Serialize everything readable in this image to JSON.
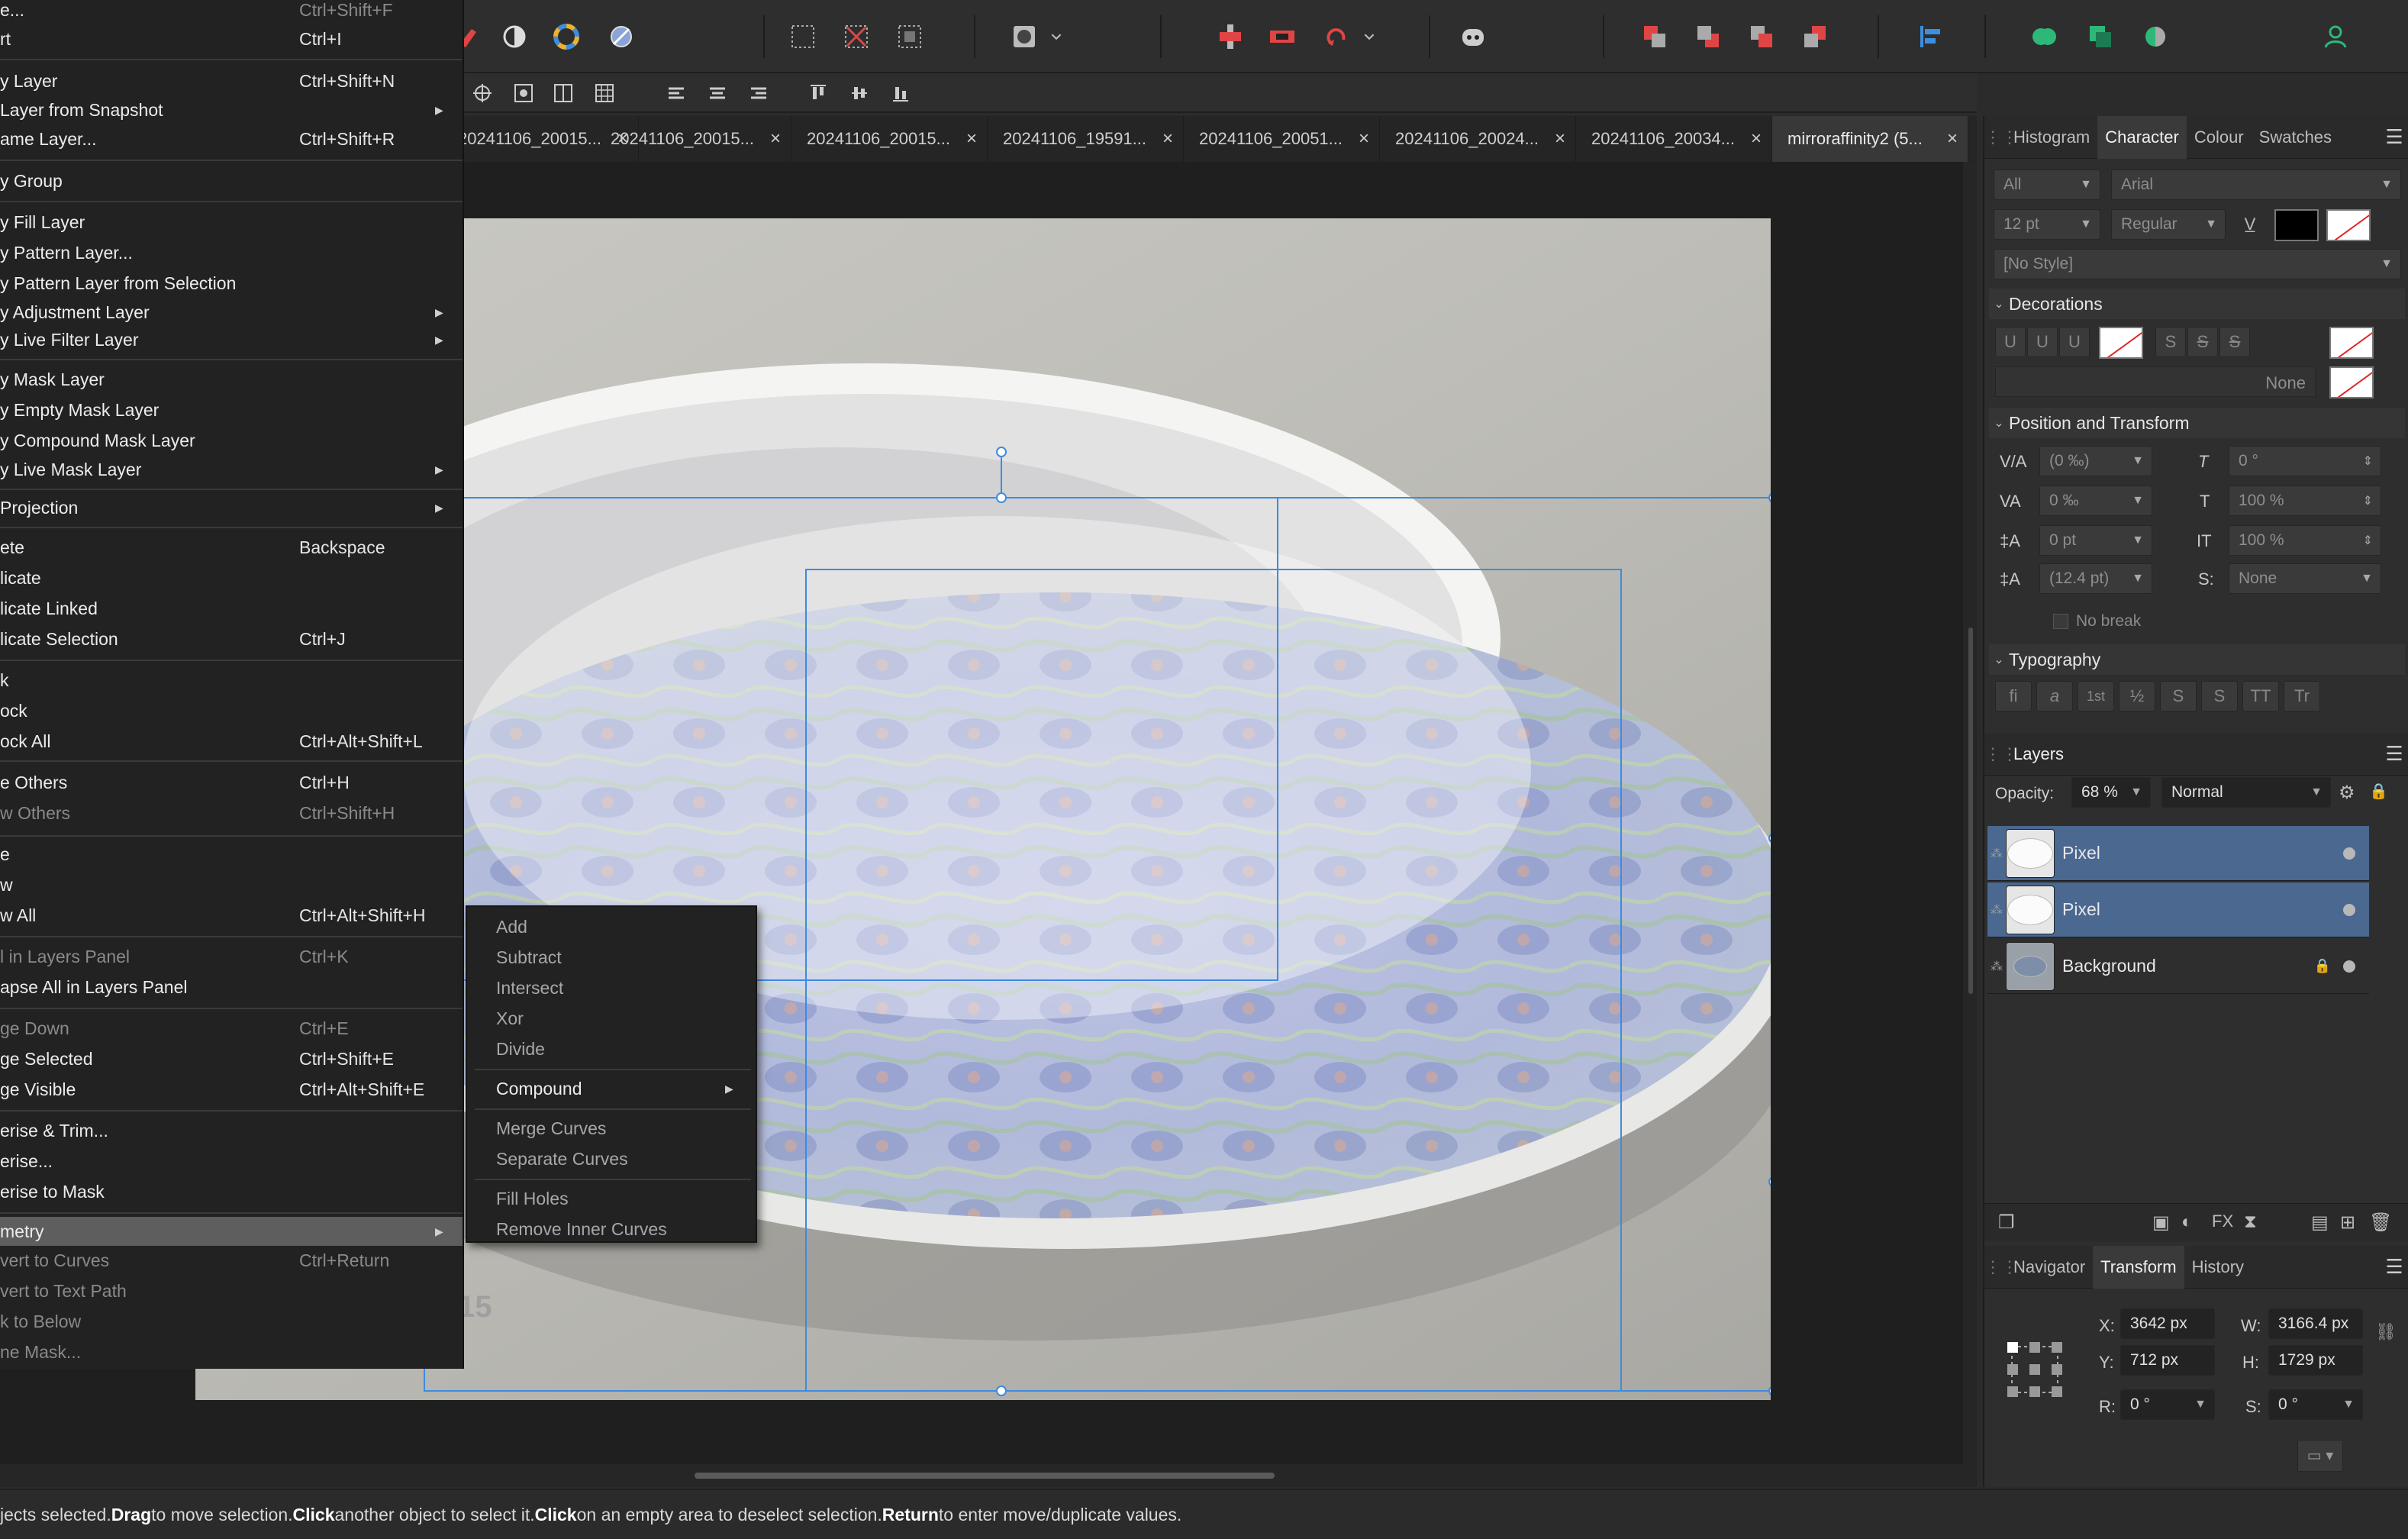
{
  "tabs": [
    {
      "label": "20241106_20015..."
    },
    {
      "label": "20241106_20015..."
    },
    {
      "label": "20241106_20015..."
    },
    {
      "label": "20241106_19591..."
    },
    {
      "label": "20241106_20051..."
    },
    {
      "label": "20241106_20024..."
    },
    {
      "label": "20241106_20034..."
    },
    {
      "label": "mirroraffinity2 (5..."
    }
  ],
  "tab_close_glyph": "×",
  "canvas_number": "15",
  "menu": {
    "items": [
      {
        "label": "e...",
        "shortcut": "Ctrl+Shift+F"
      },
      {
        "label": "rt",
        "shortcut": "Ctrl+I"
      },
      {
        "label": "y Layer",
        "shortcut": "Ctrl+Shift+N"
      },
      {
        "label": "Layer from Snapshot",
        "shortcut": ""
      },
      {
        "label": "ame Layer...",
        "shortcut": "Ctrl+Shift+R"
      },
      {
        "label": "y Group",
        "shortcut": ""
      },
      {
        "label": "y Fill Layer",
        "shortcut": ""
      },
      {
        "label": "y Pattern Layer...",
        "shortcut": ""
      },
      {
        "label": "y Pattern Layer from Selection",
        "shortcut": ""
      },
      {
        "label": "y Adjustment Layer",
        "shortcut": ""
      },
      {
        "label": "y Live Filter Layer",
        "shortcut": ""
      },
      {
        "label": "y Mask Layer",
        "shortcut": ""
      },
      {
        "label": "y Empty Mask Layer",
        "shortcut": ""
      },
      {
        "label": "y Compound Mask Layer",
        "shortcut": ""
      },
      {
        "label": "y Live Mask Layer",
        "shortcut": ""
      },
      {
        "label": "Projection",
        "shortcut": ""
      },
      {
        "label": "ete",
        "shortcut": "Backspace"
      },
      {
        "label": "licate",
        "shortcut": ""
      },
      {
        "label": "licate Linked",
        "shortcut": ""
      },
      {
        "label": "licate Selection",
        "shortcut": "Ctrl+J"
      },
      {
        "label": "k",
        "shortcut": ""
      },
      {
        "label": "ock",
        "shortcut": ""
      },
      {
        "label": "ock All",
        "shortcut": "Ctrl+Alt+Shift+L"
      },
      {
        "label": "e Others",
        "shortcut": "Ctrl+H"
      },
      {
        "label": "w Others",
        "shortcut": "Ctrl+Shift+H"
      },
      {
        "label": "e",
        "shortcut": ""
      },
      {
        "label": "w",
        "shortcut": ""
      },
      {
        "label": "w All",
        "shortcut": "Ctrl+Alt+Shift+H"
      },
      {
        "label": "l in Layers Panel",
        "shortcut": "Ctrl+K"
      },
      {
        "label": "apse All in Layers Panel",
        "shortcut": ""
      },
      {
        "label": "ge Down",
        "shortcut": "Ctrl+E"
      },
      {
        "label": "ge Selected",
        "shortcut": "Ctrl+Shift+E"
      },
      {
        "label": "ge Visible",
        "shortcut": "Ctrl+Alt+Shift+E"
      },
      {
        "label": "erise & Trim...",
        "shortcut": ""
      },
      {
        "label": "erise...",
        "shortcut": ""
      },
      {
        "label": "erise to Mask",
        "shortcut": ""
      },
      {
        "label": "metry",
        "shortcut": ""
      },
      {
        "label": "vert to Curves",
        "shortcut": "Ctrl+Return"
      },
      {
        "label": "vert to Text Path",
        "shortcut": ""
      },
      {
        "label": "k to Below",
        "shortcut": ""
      },
      {
        "label": "ne Mask...",
        "shortcut": ""
      }
    ],
    "arrow_glyph": "▶"
  },
  "submenu": {
    "items": [
      "Add",
      "Subtract",
      "Intersect",
      "Xor",
      "Divide",
      "Compound",
      "Merge Curves",
      "Separate Curves",
      "Fill Holes",
      "Remove Inner Curves"
    ]
  },
  "panel": {
    "top_tabs": [
      "Histogram",
      "Character",
      "Colour",
      "Swatches"
    ],
    "character": {
      "font_collection": "All",
      "font_family": "Arial",
      "font_size": "12 pt",
      "font_style": "Regular",
      "paragraph_style": "[No Style]",
      "decorations_title": "Decorations",
      "decoration_none": "None",
      "position_title": "Position and Transform",
      "kerning": "(0 ‰)",
      "tracking": "0 ‰",
      "baseline": "0 pt",
      "leading": "(12.4 pt)",
      "shear": "0 °",
      "scale_h": "100 %",
      "scale_v": "100 %",
      "typography_case": "None",
      "no_break": "No break",
      "typography_title": "Typography",
      "deco_glyphs": [
        "U",
        "U",
        "U",
        "S",
        "S",
        "S"
      ],
      "typo_glyphs": [
        "fi",
        "a",
        "1st",
        "½",
        "S",
        "S",
        "TT",
        "Tr"
      ],
      "accent_colors": {
        "fill": "#000000"
      }
    },
    "layers": {
      "tab": "Layers",
      "opacity_label": "Opacity:",
      "opacity": "68 %",
      "blend_mode": "Normal",
      "rows": [
        {
          "name": "Pixel",
          "selected": true
        },
        {
          "name": "Pixel",
          "selected": true
        },
        {
          "name": "Background",
          "selected": false
        }
      ]
    },
    "bottom_tabs": [
      "Navigator",
      "Transform",
      "History"
    ],
    "transform": {
      "x_label": "X:",
      "x": "3642 px",
      "y_label": "Y:",
      "y": "712 px",
      "w_label": "W:",
      "w": "3166.4 px",
      "h_label": "H:",
      "h": "1729 px",
      "r_label": "R:",
      "r": "0 °",
      "s_label": "S:",
      "s": "0 °"
    }
  },
  "status": {
    "p1": "jects selected. ",
    "k1": "Drag",
    "p2": " to move selection. ",
    "k2": "Click",
    "p3": " another object to select it. ",
    "k3": "Click",
    "p4": " on an empty area to deselect selection. ",
    "k4": "Return",
    "p5": " to enter move/duplicate values."
  },
  "colors": {
    "accent_selection": "#4a6890",
    "guide_blue": "#3d8be0"
  }
}
